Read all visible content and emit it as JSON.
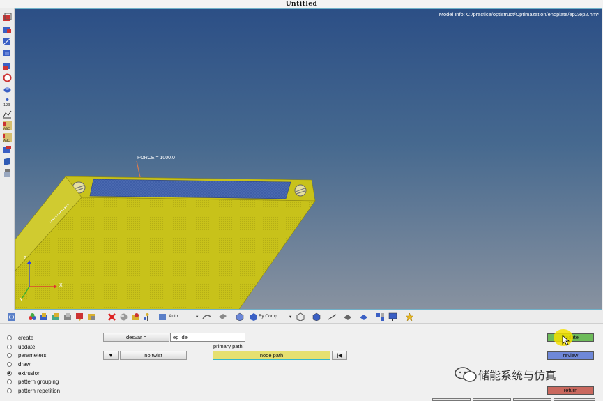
{
  "window": {
    "title": "Untitled"
  },
  "viewport": {
    "model_info": "Model Info: C:/practice/optistruct/Optimazation/endplate/ep2/ep2.hm*",
    "load_label": "FORCE = 1000.0",
    "axes": {
      "x": "X",
      "y": "Y",
      "z": "Z"
    }
  },
  "left_toolbar": {
    "icons": [
      "component-icon",
      "material-icon",
      "property-icon",
      "load-collector-icon",
      "system-icon",
      "set-icon",
      "surface-icon",
      "id-info-icon",
      "curve-icon",
      "abc-label-icon",
      "abc-label-icon-2",
      "mesh-icon",
      "plane-icon",
      "bottle-icon"
    ]
  },
  "main_toolbar": {
    "auto_label": "Auto",
    "by_comp_label": "By Comp"
  },
  "panel": {
    "radios": [
      {
        "label": "create",
        "selected": false
      },
      {
        "label": "update",
        "selected": false
      },
      {
        "label": "parameters",
        "selected": false
      },
      {
        "label": "draw",
        "selected": false
      },
      {
        "label": "extrusion",
        "selected": true
      },
      {
        "label": "pattern grouping",
        "selected": false
      },
      {
        "label": "pattern repetition",
        "selected": false
      }
    ],
    "desvar_label": "desvar =",
    "desvar_value": "ep_de",
    "twist_label": "no twist",
    "primary_path_label": "primary path:",
    "node_path_label": "node path",
    "reset_glyph": "|◀",
    "update_label": "update",
    "review_label": "review",
    "return_label": "return"
  },
  "watermark": {
    "text": "储能系统与仿真"
  },
  "colors": {
    "update_btn": "#6dbb5a",
    "review_btn": "#6f88d8",
    "return_btn": "#c9685e",
    "node_path_bg": "#e6e070",
    "plate_yellow": "#c8c21a",
    "cursor_highlight": "#f5e000"
  }
}
